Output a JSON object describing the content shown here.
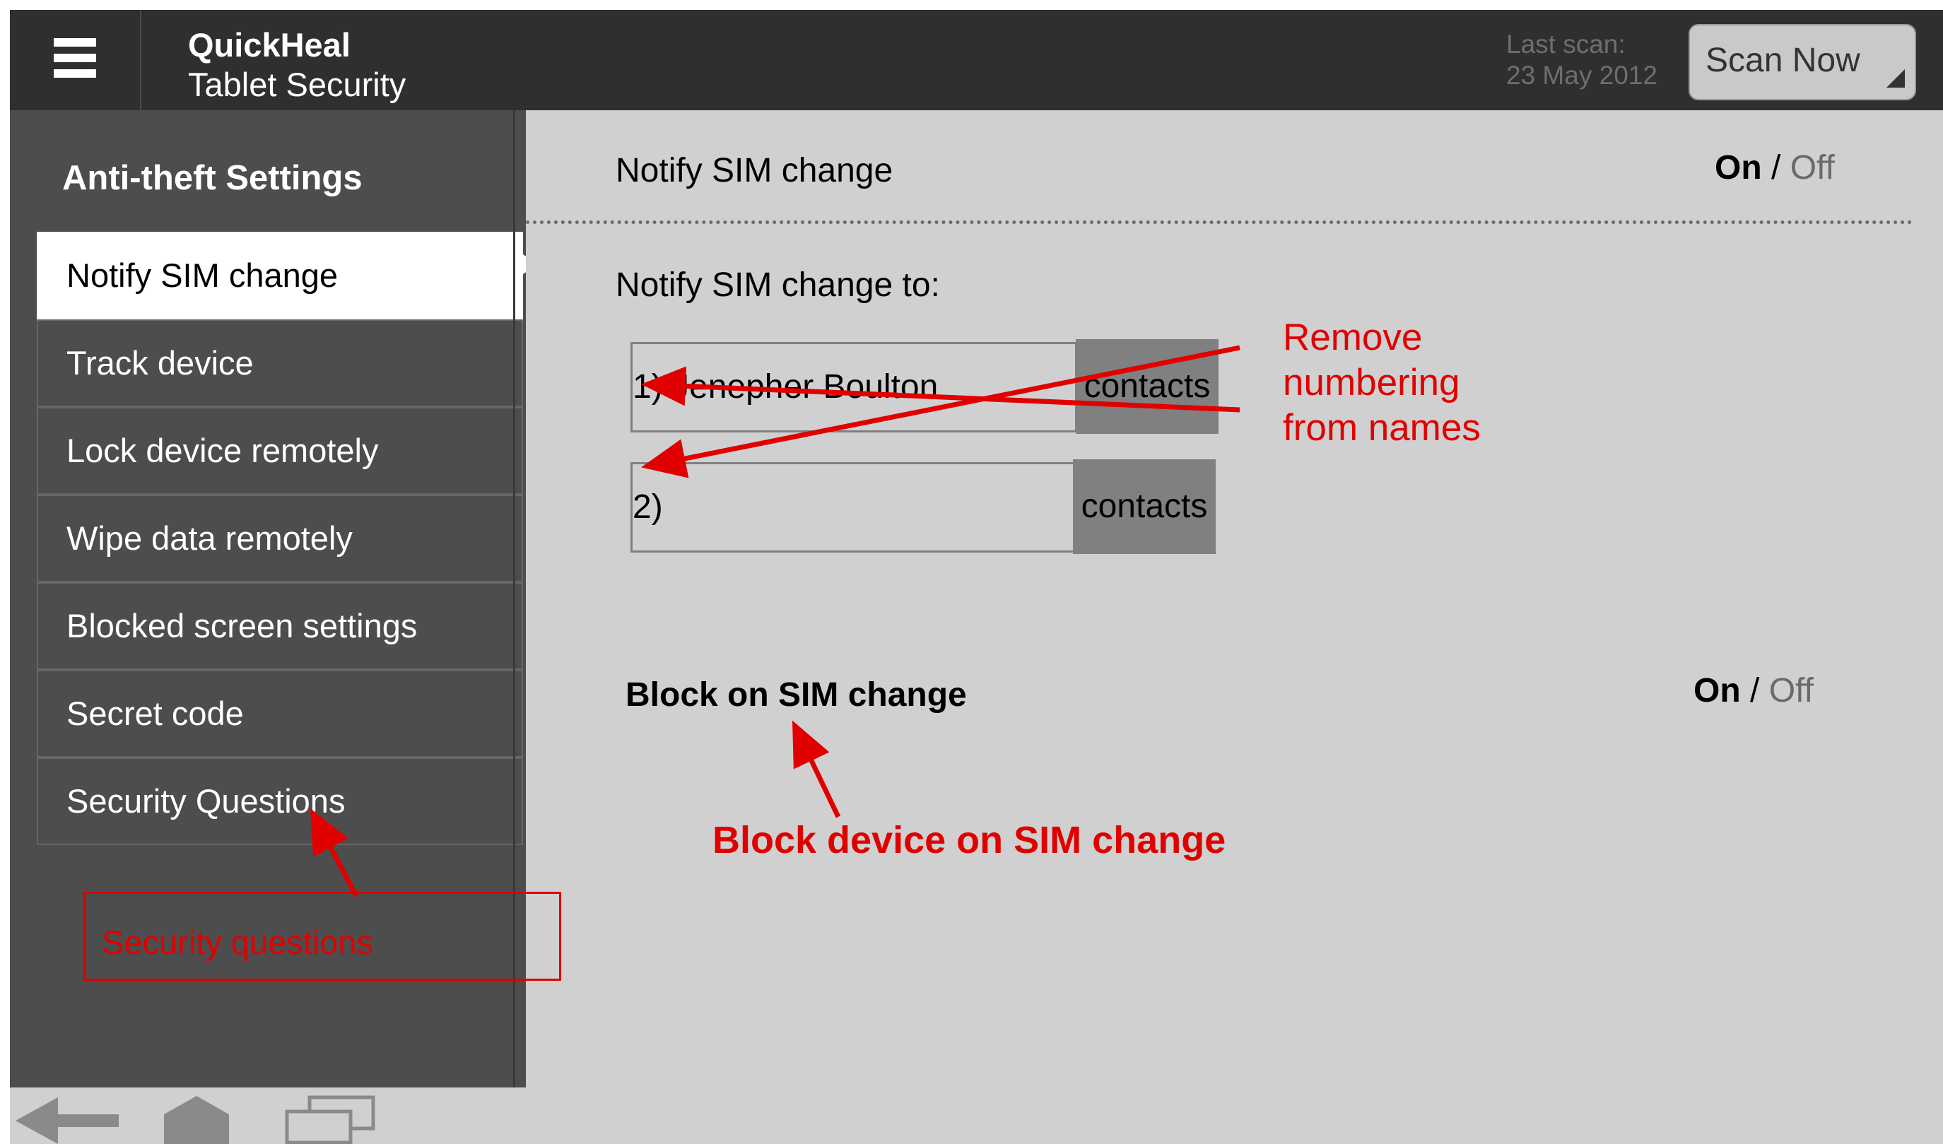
{
  "header": {
    "app_title": "QuickHeal",
    "app_subtitle": "Tablet Security",
    "last_scan_label": "Last scan:",
    "last_scan_date": "23 May 2012",
    "scan_button": "Scan Now"
  },
  "sidebar": {
    "title": "Anti-theft Settings",
    "items": [
      {
        "label": "Notify SIM change",
        "active": true
      },
      {
        "label": "Track device"
      },
      {
        "label": "Lock device remotely"
      },
      {
        "label": "Wipe data remotely"
      },
      {
        "label": "Blocked screen settings"
      },
      {
        "label": "Secret code"
      },
      {
        "label": "Security Questions"
      }
    ]
  },
  "main": {
    "notify_title": "Notify SIM change",
    "notify_toggle": {
      "on": "On",
      "sep": "/",
      "off": "Off"
    },
    "notify_to_label": "Notify SIM change to:",
    "contacts": [
      {
        "value": "1) Jenepher Boulton",
        "button": "contacts"
      },
      {
        "value": "2)",
        "button": "contacts"
      }
    ],
    "block_title": "Block on SIM change",
    "block_toggle": {
      "on": "On",
      "sep": "/",
      "off": "Off"
    }
  },
  "annotations": {
    "remove_numbering": [
      "Remove",
      "numbering",
      "from names"
    ],
    "block_device": "Block device on SIM change",
    "security_questions": "Security questions",
    "color": "#e00000"
  },
  "bottom_nav": {
    "icons": [
      "back-icon",
      "home-icon",
      "recent-apps-icon"
    ]
  },
  "colors": {
    "header_bg": "#2f2f2f",
    "sidebar_bg": "#4d4d4d",
    "main_bg": "#d0d0d0",
    "button_gray": "#808080",
    "annotation_red": "#e00000"
  }
}
